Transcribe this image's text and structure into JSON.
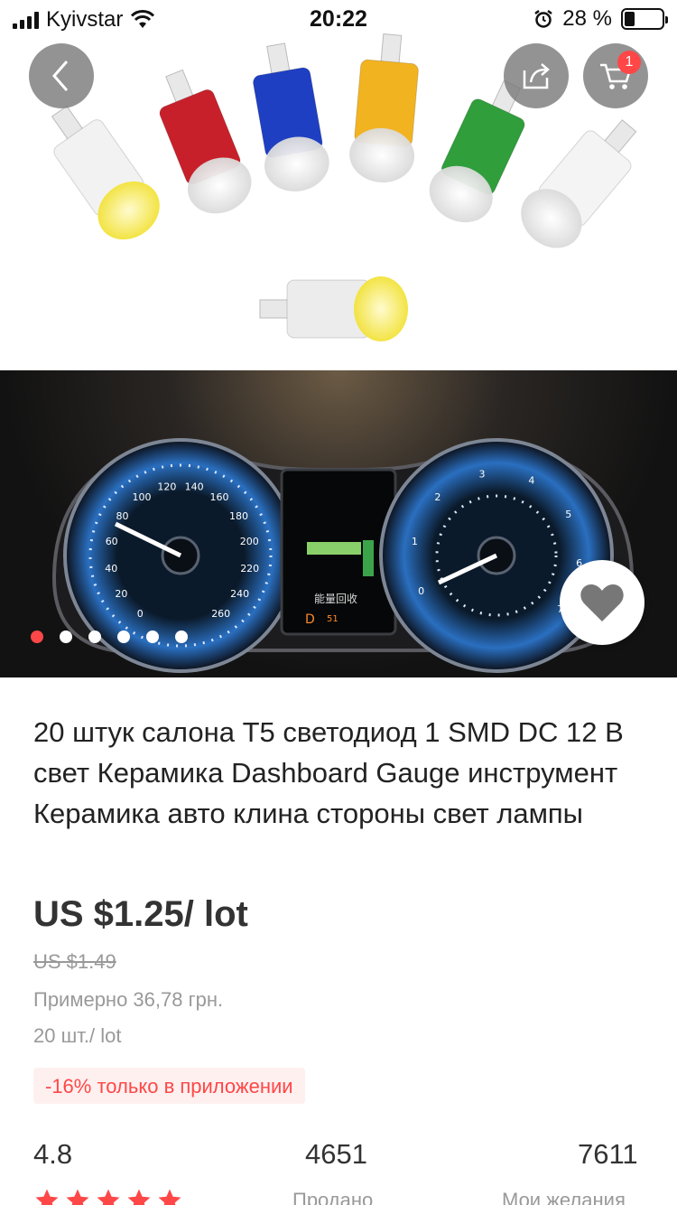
{
  "status_bar": {
    "carrier": "Kyivstar",
    "time": "20:22",
    "battery": "28 %",
    "battery_level": 0.28
  },
  "header": {
    "cart_count": "1"
  },
  "gallery": {
    "slide_count": 6,
    "active_index": 0,
    "gauges": {
      "left_ticks": [
        "0",
        "20",
        "40",
        "60",
        "80",
        "100",
        "120",
        "140",
        "160",
        "180",
        "200",
        "220",
        "240",
        "260"
      ],
      "right_ticks": [
        "0",
        "1",
        "2",
        "3",
        "4",
        "5",
        "6",
        "7"
      ],
      "display_text": "能量回收",
      "display_gear": "D",
      "display_value": "51"
    }
  },
  "product": {
    "title": "20 штук салона T5 светодиод 1 SMD DC 12 В свет Керамика Dashboard Gauge инструмент Керамика авто клина стороны свет лампы",
    "price": "US $1.25/ lot",
    "old_price": "US $1.49",
    "approx_price": "Примерно 36,78 грн.",
    "lot_size": "20 шт./ lot",
    "promo": "-16% только в приложении"
  },
  "stats": {
    "rating": "4.8",
    "rating_stars": 5,
    "sold": "4651",
    "sold_label": "Продано",
    "wishlist": "7611",
    "wishlist_label": "Мои желания"
  },
  "colors": {
    "accent": "#ff4747",
    "bulbs": [
      "#f2f2f2",
      "#c8202a",
      "#1f3fc2",
      "#f2b321",
      "#2f9e3b",
      "#f4f4f4",
      "#ececec"
    ]
  }
}
